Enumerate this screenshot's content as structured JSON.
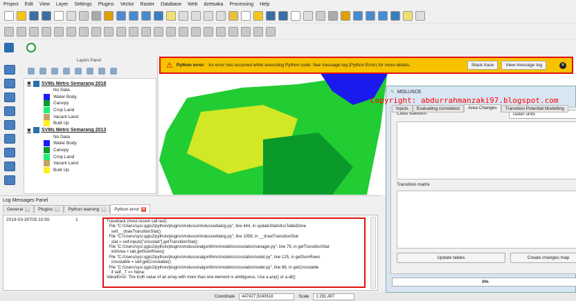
{
  "menu": [
    "Project",
    "Edit",
    "View",
    "Layer",
    "Settings",
    "Plugins",
    "Vector",
    "Raster",
    "Database",
    "Web",
    "dzetsaka",
    "Processing",
    "Help"
  ],
  "layers_panel": {
    "title": "Layers Panel",
    "groups": [
      {
        "name": "SVMs Metro Semarang 2018",
        "legend": [
          {
            "label": "No Data",
            "color": "#ffffff"
          },
          {
            "label": "Water Body",
            "color": "#1a1aff"
          },
          {
            "label": "Canopy",
            "color": "#0a9a2a"
          },
          {
            "label": "Crop Land",
            "color": "#22ee77"
          },
          {
            "label": "Vacant Land",
            "color": "#c8a060"
          },
          {
            "label": "Built Up",
            "color": "#ffee22"
          }
        ]
      },
      {
        "name": "SVMs Metro Semarang 2013",
        "legend": [
          {
            "label": "No Data",
            "color": "#ffffff"
          },
          {
            "label": "Water Body",
            "color": "#1a1aff"
          },
          {
            "label": "Canopy",
            "color": "#0a9a2a"
          },
          {
            "label": "Crop Land",
            "color": "#22ee77"
          },
          {
            "label": "Vacant Land",
            "color": "#c8a060"
          },
          {
            "label": "Built Up",
            "color": "#ffee22"
          }
        ]
      }
    ]
  },
  "message_bar": {
    "title": "Python error:",
    "text": "An error has occurred while executing Python code: See message log (Python Error) for more details.",
    "stack_trace": "Stack trace",
    "view_log": "View message log"
  },
  "log": {
    "title": "Log Messages Panel",
    "tabs": [
      "General",
      "Plugins",
      "Python warning",
      "Python error"
    ],
    "timestamp": "2019-03-30T05:10:55",
    "level": "1",
    "traceback": "Traceback (most recent call last):\n  File \"C:/Users/sys/.qgis2/python/plugins\\molusce\\moluscedialog.py\", line 444, in updateStatisticsTableDone\n    self.__drawTransitionStat()\n  File \"C:/Users/sys/.qgis2/python/plugins\\molusce\\moluscedialog.py\", line 1058, in __drawTransitionStat\n    stat = self.inputs[\"crosstab\"].getTransitionStat()\n  File \"C:/Users/sys/.qgis2/python/plugins\\molusce\\algorithms\\models\\crosstabs\\manager.py\", line 79, in getTransitionStat\n    initArea = tab.getSumRows()\n  File \"C:/Users/sys/.qgis2/python/plugins\\molusce\\algorithms\\models\\crosstabs\\model.py\", line 125, in getSumRows\n    crosstable = self.getCrosstable()\n  File \"C:/Users/sys/.qgis2/python/plugins\\molusce\\algorithms\\models\\crosstabs\\model.py\", line 86, in getCrosstable\n    if self._T == None:\nValueError: The truth value of an array with more than one element is ambiguous. Use a.any() or a.all()"
  },
  "status": {
    "coordinate_label": "Coordinate",
    "coordinate": "447427,9240618",
    "scale_label": "Scale",
    "scale": "1:291,487"
  },
  "dialog": {
    "title": "MOLUSCE",
    "tabs": [
      "Inputs",
      "Evaluating correlation",
      "Area Changes",
      "Transition Potential Modelling"
    ],
    "class_statistics": "Class statistics",
    "units": "raster units",
    "transition_matrix": "Transition matrix",
    "update": "Update tables",
    "create": "Create changes map",
    "progress": "0%",
    "progress_value": 0
  },
  "watermark": "Copyright: abdurrahmanzaki97.blogspot.com"
}
